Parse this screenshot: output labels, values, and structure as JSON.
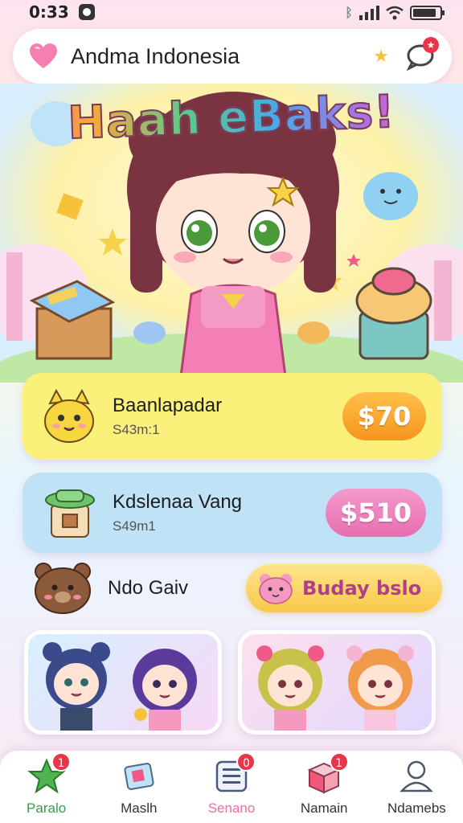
{
  "status_bar": {
    "time": "0:33"
  },
  "header": {
    "title": "Andma Indonesia",
    "icon": "heart-icon",
    "chat_badge": "★"
  },
  "hero": {
    "title": "Haah eBaks!",
    "character": "chibi-girl-brown-hair-pink-dress"
  },
  "list": [
    {
      "name": "Baanlapadar",
      "sub": "S43m:1",
      "price": "$70",
      "icon": "yellow-cat-icon",
      "price_color": "#f5951d"
    },
    {
      "name": "Kdslenaa Vang",
      "sub": "S49m1",
      "price": "$510",
      "icon": "green-hat-box-icon",
      "price_color": "#e66eb0"
    }
  ],
  "row_third": {
    "name": "Ndo Gaiv",
    "icon": "brown-bear-icon",
    "button_label": "Buday bslo"
  },
  "bottom_nav": [
    {
      "label": "Paralo",
      "badge": "1",
      "icon": "star-icon"
    },
    {
      "label": "Maslh",
      "badge": "",
      "icon": "card-icon"
    },
    {
      "label": "Senano",
      "badge": "0",
      "icon": "list-icon"
    },
    {
      "label": "Namain",
      "badge": "1",
      "icon": "box-icon"
    },
    {
      "label": "Ndamebs",
      "badge": "",
      "icon": "profile-icon"
    }
  ]
}
